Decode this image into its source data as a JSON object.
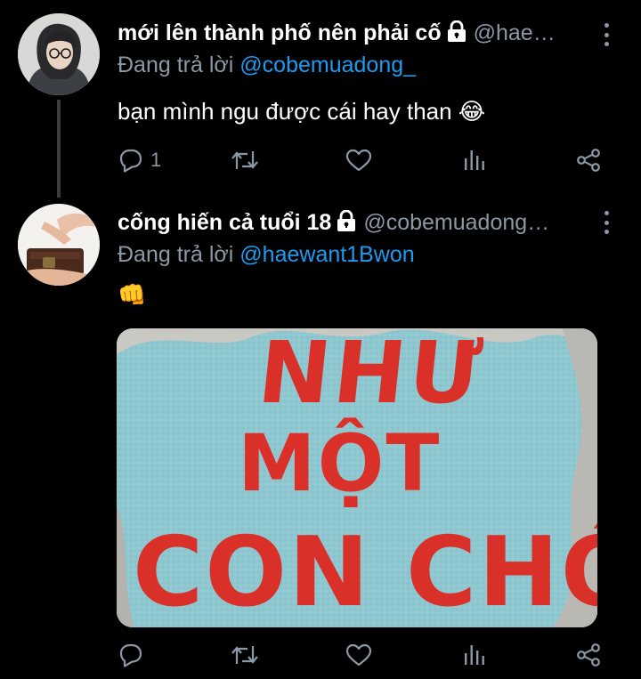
{
  "tweets": [
    {
      "display_name": "mới lên thành phố nên phải cố",
      "handle": "@hae…",
      "replying_prefix": "Đang trả lời",
      "replying_to": "@cobemuadong_",
      "text": "bạn mình ngu được cái hay than 😂",
      "reply_count": "1"
    },
    {
      "display_name": "cống hiến cả tuổi 18",
      "handle": "@cobemuadong…",
      "replying_prefix": "Đang trả lời",
      "replying_to": "@haewant1Bwon",
      "text": "👊",
      "media_caption_lines": [
        "NHƯ",
        "MỘT",
        "CON CHÓ"
      ]
    }
  ],
  "colors": {
    "background": "#000000",
    "secondary_text": "#8b98a5",
    "mention": "#1d9bf0",
    "media_background": "#8ec7cf",
    "media_lettering": "#d9302a"
  },
  "icons": [
    "lock-icon",
    "more-icon",
    "reply-icon",
    "retweet-icon",
    "like-icon",
    "analytics-icon",
    "share-icon"
  ]
}
